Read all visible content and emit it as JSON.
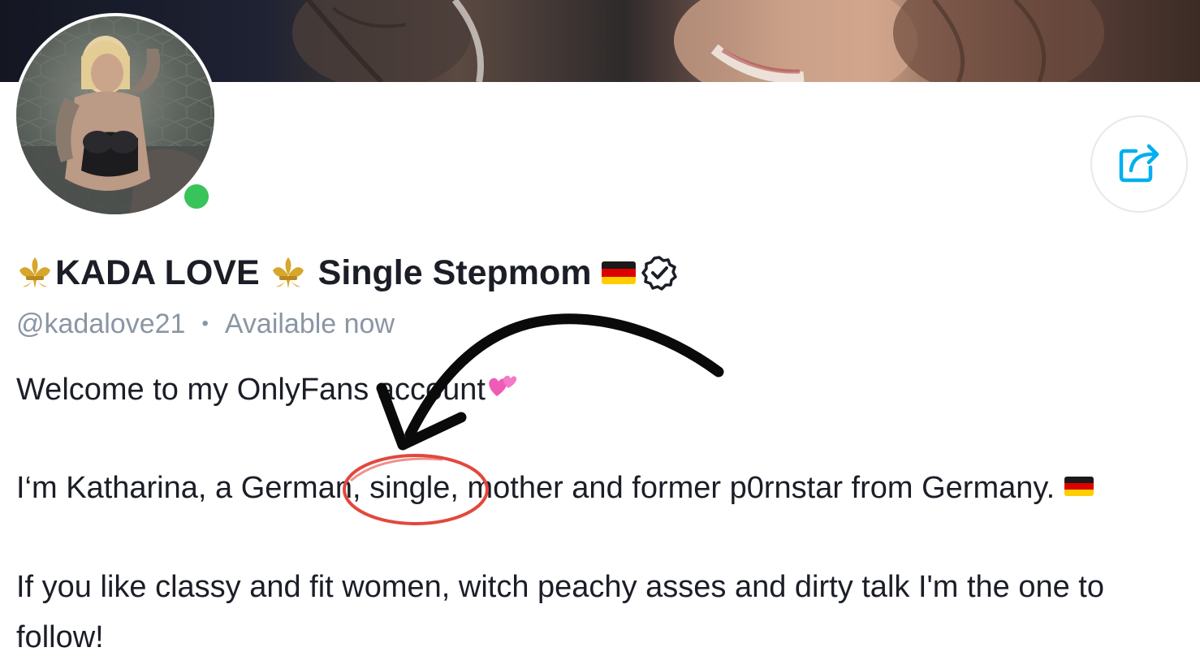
{
  "profile": {
    "name_prefix": "KADA LOVE",
    "name_suffix": "Single Stepmom",
    "username": "@kadalove21",
    "status": "Available now",
    "online": true
  },
  "bio": {
    "line1": "Welcome to my OnlyFans account",
    "line2": "I‘m Katharina, a German, single, mother and former p0rnstar from Germany.",
    "line3": "If you like classy and fit women, witch peachy asses and dirty talk I'm the one to",
    "line4": "follow!"
  },
  "icons": {
    "name_icons": [
      "fleur-de-lis-icon",
      "fleur-de-lis-icon",
      "german-flag-icon",
      "verified-badge-icon"
    ],
    "share": "share-icon",
    "bio_emoji": [
      "two-hearts-icon",
      "german-flag-icon"
    ]
  },
  "colors": {
    "online": "#39c35b",
    "accent_blue": "#00aff0",
    "meta_gray": "#8a96a3",
    "annotation_red": "#e2483d",
    "annotation_arrow": "#0a0a0a"
  }
}
